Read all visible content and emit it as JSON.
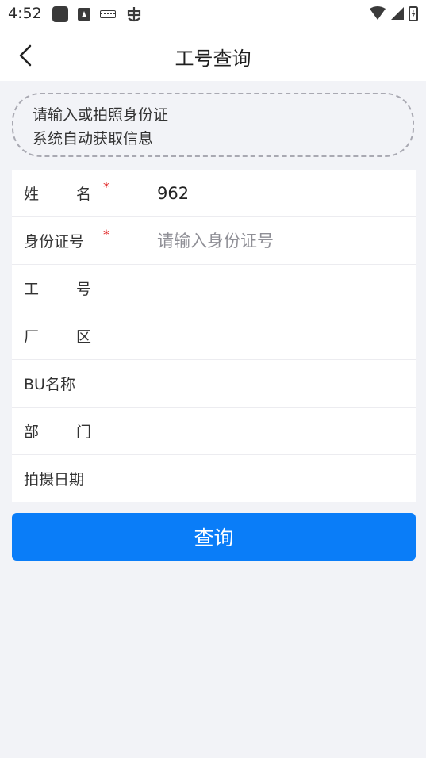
{
  "status_bar": {
    "time": "4:52"
  },
  "nav": {
    "title": "工号查询"
  },
  "scan": {
    "line1": "请输入或拍照身份证",
    "line2": "系统自动获取信息"
  },
  "form": {
    "name_label_a": "姓",
    "name_label_b": "名",
    "name_required": "*",
    "name_value": "962",
    "id_label": "身份证号",
    "id_required": "*",
    "id_placeholder": "请输入身份证号",
    "empno_label_a": "工",
    "empno_label_b": "号",
    "area_label_a": "厂",
    "area_label_b": "区",
    "bu_label": "BU名称",
    "dept_label_a": "部",
    "dept_label_b": "门",
    "date_label": "拍摄日期"
  },
  "actions": {
    "query_label": "查询"
  }
}
